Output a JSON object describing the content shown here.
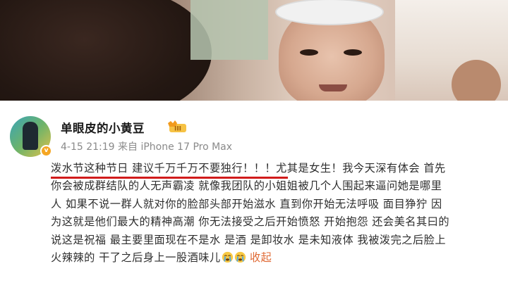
{
  "post": {
    "username": "单眼皮的小黄豆",
    "level_badge_text": "III",
    "verified_badge": "v",
    "meta": "4-15 21:19  来自 iPhone 17 Pro Max",
    "body_lines": [
      "泼水节这种节日 建议千万千万不要独行！！！尤其是女生！我今天深有体会 首先",
      "你会被成群结队的人无声霸凌 就像我团队的小姐姐被几个人围起来逼问她是哪里",
      "人 如果不说一群人就对你的脸部头部开始滋水 直到你开始无法呼吸 面目狰狞 因",
      "为这就是他们最大的精神高潮 你无法接受之后开始愤怒 开始抱怨 还会美名其曰的",
      "说这是祝福 最主要里面现在不是水 是酒 是卸妆水 是未知液体 我被泼完之后脸上",
      "火辣辣的 干了之后身上一股酒味儿"
    ],
    "collapse_label": "收起",
    "emojis": [
      "crying-face-icon",
      "crying-face-icon"
    ]
  },
  "colors": {
    "highlight_underline": "#d11b1b",
    "link": "#e06a35",
    "badge_gold": "#f5a623"
  }
}
